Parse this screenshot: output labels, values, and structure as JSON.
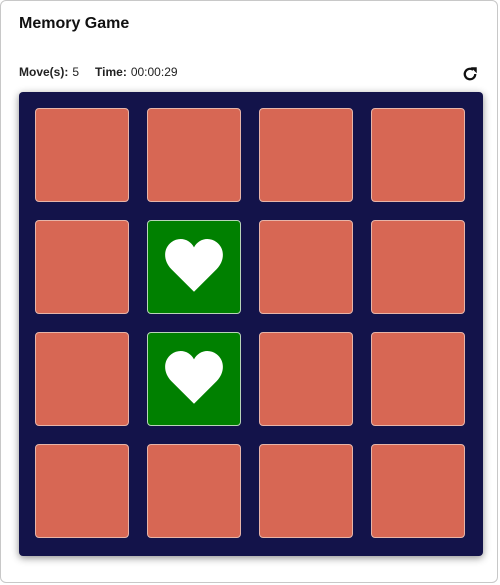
{
  "game": {
    "title": "Memory Game",
    "moves_label": "Move(s):",
    "moves_value": "5",
    "time_label": "Time:",
    "time_value": "00:00:29",
    "restart_icon": "restart-icon"
  },
  "colors": {
    "board": "#13134a",
    "card_back": "#d76754",
    "card_matched": "#008000",
    "symbol": "#ffffff"
  },
  "cards": [
    {
      "state": "hidden"
    },
    {
      "state": "hidden"
    },
    {
      "state": "hidden"
    },
    {
      "state": "hidden"
    },
    {
      "state": "hidden"
    },
    {
      "state": "matched",
      "icon": "heart-icon"
    },
    {
      "state": "hidden"
    },
    {
      "state": "hidden"
    },
    {
      "state": "hidden"
    },
    {
      "state": "matched",
      "icon": "heart-icon"
    },
    {
      "state": "hidden"
    },
    {
      "state": "hidden"
    },
    {
      "state": "hidden"
    },
    {
      "state": "hidden"
    },
    {
      "state": "hidden"
    },
    {
      "state": "hidden"
    }
  ]
}
